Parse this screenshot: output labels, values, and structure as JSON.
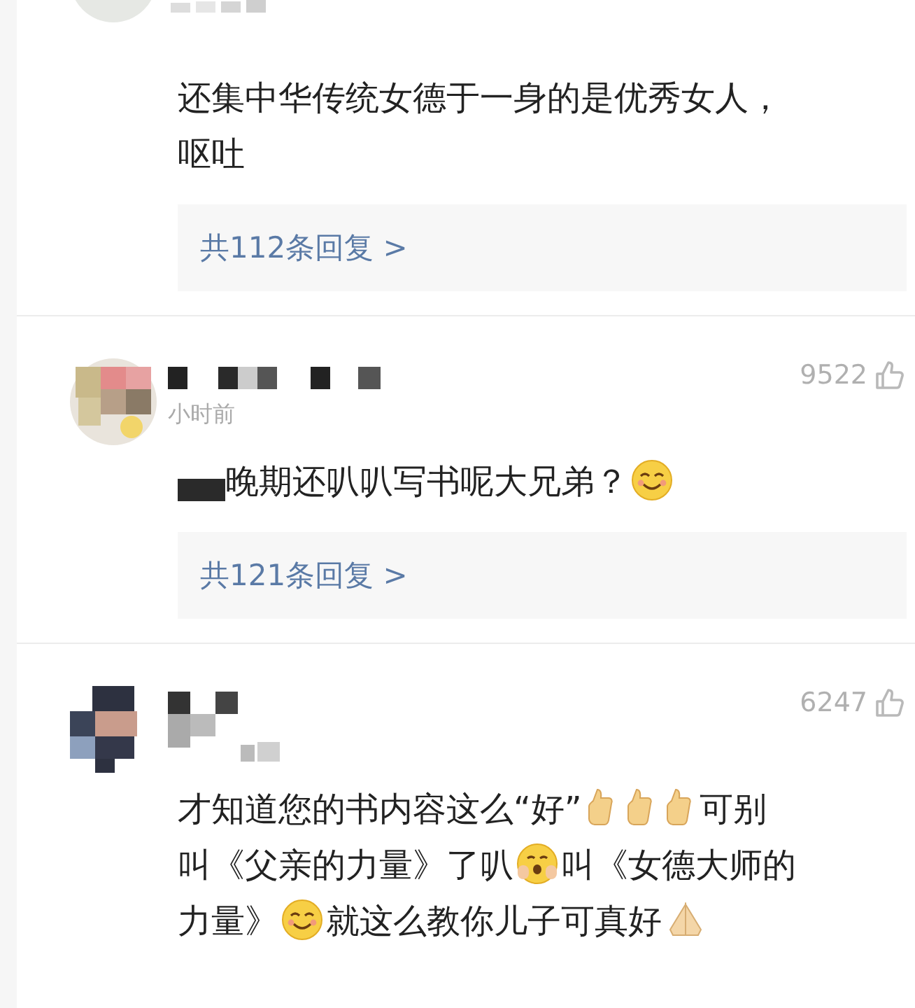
{
  "comments": [
    {
      "kind": "cut-off",
      "body": [
        {
          "kind": "text",
          "text": "还集中华传统女德于一身的是优秀女人，"
        },
        {
          "kind": "break"
        },
        {
          "kind": "text",
          "text": "呕吐"
        }
      ],
      "replies": "共112条回复 >"
    },
    {
      "kind": "full",
      "likes": "9522",
      "time": "小时前",
      "body": [
        {
          "kind": "redacted"
        },
        {
          "kind": "text",
          "text": "晚期还叭叭写书呢大兄弟？"
        },
        {
          "kind": "smile"
        }
      ],
      "replies": "共121条回复 >"
    },
    {
      "kind": "full",
      "likes": "6247",
      "body": [
        {
          "kind": "text",
          "text": "才知道您的书内容这么“好”"
        },
        {
          "kind": "thumbs-up"
        },
        {
          "kind": "thumbs-up"
        },
        {
          "kind": "thumbs-up"
        },
        {
          "kind": "text",
          "text": "可别"
        },
        {
          "kind": "break"
        },
        {
          "kind": "text",
          "text": "叫《父亲的力量》了叭"
        },
        {
          "kind": "shy"
        },
        {
          "kind": "text",
          "text": "叫《女德大师的"
        },
        {
          "kind": "break"
        },
        {
          "kind": "text",
          "text": "力量》"
        },
        {
          "kind": "smile"
        },
        {
          "kind": "text",
          "text": "就这么教你儿子可真好"
        },
        {
          "kind": "hands"
        }
      ]
    }
  ]
}
